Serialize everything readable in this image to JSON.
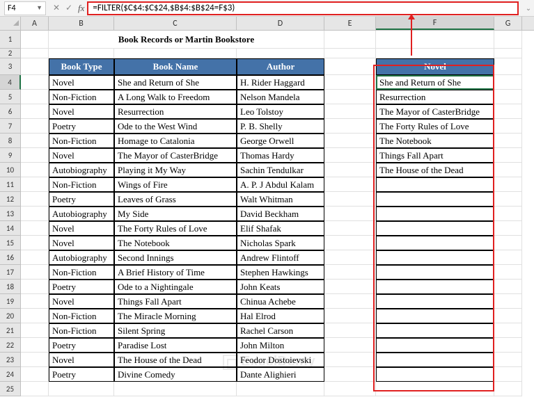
{
  "name_box": "F4",
  "formula": "=FILTER($C$4:$C$24,$B$4:$B$24=F$3)",
  "columns": [
    "A",
    "B",
    "C",
    "D",
    "E",
    "F",
    "G"
  ],
  "title": "Book Records or Martin Bookstore",
  "headers": {
    "b": "Book Type",
    "c": "Book Name",
    "d": "Author"
  },
  "filter_header": "Novel",
  "table": [
    {
      "b": "Novel",
      "c": "She and Return of She",
      "d": "H. Rider Haggard"
    },
    {
      "b": "Non-Fiction",
      "c": "A Long Walk to Freedom",
      "d": "Nelson Mandela"
    },
    {
      "b": "Novel",
      "c": "Resurrection",
      "d": "Leo Tolstoy"
    },
    {
      "b": "Poetry",
      "c": "Ode to the West Wind",
      "d": "P. B. Shelly"
    },
    {
      "b": "Non-Fiction",
      "c": "Homage to Catalonia",
      "d": "George Orwell"
    },
    {
      "b": "Novel",
      "c": "The Mayor of CasterBridge",
      "d": "Thomas Hardy"
    },
    {
      "b": "Autobiography",
      "c": "Playing it My Way",
      "d": "Sachin Tendulkar"
    },
    {
      "b": "Non-Fiction",
      "c": "Wings of Fire",
      "d": "A. P. J Abdul Kalam"
    },
    {
      "b": "Poetry",
      "c": "Leaves of Grass",
      "d": "Walt Whitman"
    },
    {
      "b": "Autobiography",
      "c": "My Side",
      "d": "David Beckham"
    },
    {
      "b": "Novel",
      "c": "The Forty Rules of Love",
      "d": "Elif Shafak"
    },
    {
      "b": "Novel",
      "c": "The Notebook",
      "d": "Nicholas Spark"
    },
    {
      "b": "Autobiography",
      "c": "Second Innings",
      "d": "Andrew Flintoff"
    },
    {
      "b": "Non-Fiction",
      "c": "A Brief History of Time",
      "d": "Stephen Hawkings"
    },
    {
      "b": "Poetry",
      "c": "Ode to a Nightingale",
      "d": "John Keats"
    },
    {
      "b": "Novel",
      "c": "Things Fall Apart",
      "d": "Chinua Achebe"
    },
    {
      "b": "Non-Fiction",
      "c": "The Miracle Morning",
      "d": "Hal Elrod"
    },
    {
      "b": "Non-Fiction",
      "c": "Silent Spring",
      "d": "Rachel Carson"
    },
    {
      "b": "Poetry",
      "c": "Paradise Lost",
      "d": "John Milton"
    },
    {
      "b": "Novel",
      "c": "The House of the Dead",
      "d": "Feodor Dostoievski"
    },
    {
      "b": "Poetry",
      "c": "Divine Comedy",
      "d": "Dante Alighieri"
    }
  ],
  "filter_result": [
    "She and Return of She",
    "Resurrection",
    "The Mayor of CasterBridge",
    "The Forty Rules of Love",
    "The Notebook",
    "Things Fall Apart",
    "The House of the Dead"
  ],
  "watermark": "ExcelDemy"
}
